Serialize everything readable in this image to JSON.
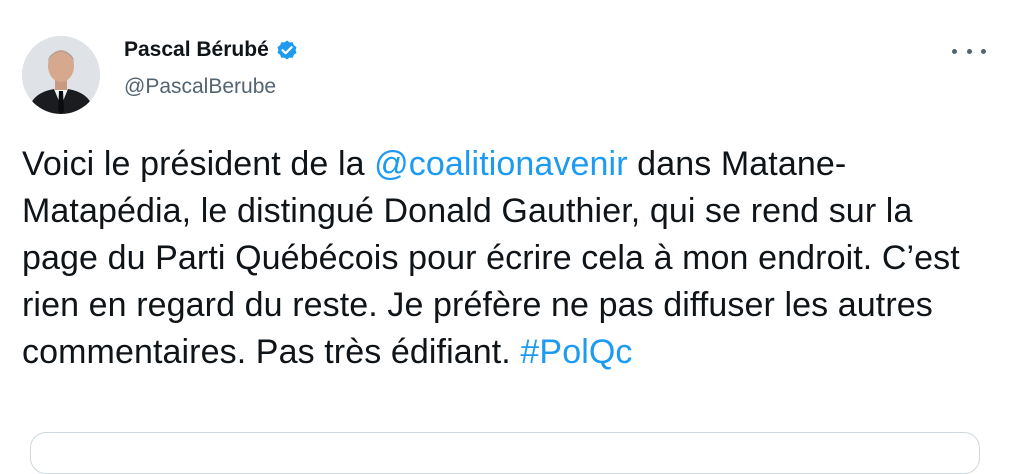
{
  "author": {
    "display_name": "Pascal Bérubé",
    "handle": "@PascalBerube",
    "verified": true,
    "avatar_icon": "profile-photo"
  },
  "tweet": {
    "segments": [
      {
        "type": "text",
        "value": "Voici le président de la "
      },
      {
        "type": "mention",
        "value": "@coalitionavenir"
      },
      {
        "type": "text",
        "value": " dans Matane-Matapédia, le distingué Donald Gauthier, qui se rend sur la page du Parti Québécois pour écrire cela à mon endroit. C’est rien en regard du reste. Je préfère ne pas diffuser les autres commentaires. Pas très édifiant. "
      },
      {
        "type": "hashtag",
        "value": "#PolQc"
      }
    ]
  },
  "colors": {
    "link": "#1d9bf0",
    "text": "#0f1419",
    "secondary": "#536471",
    "verified_badge": "#1d9bf0"
  },
  "icons": {
    "more": "more-horizontal-icon",
    "verified": "verified-badge-icon"
  }
}
